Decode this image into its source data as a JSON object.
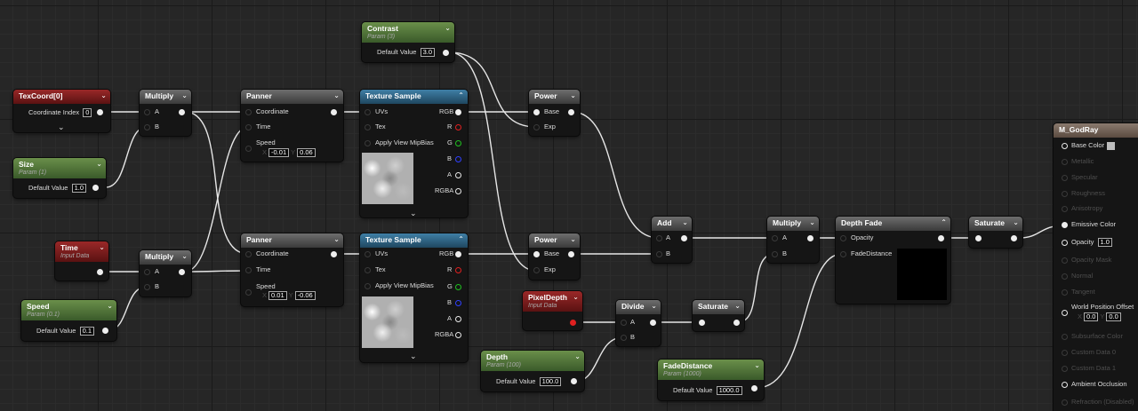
{
  "nodes": {
    "texcoord": {
      "title": "TexCoord[0]",
      "coordinate_index_label": "Coordinate Index",
      "coordinate_index_value": "0"
    },
    "size": {
      "title": "Size",
      "subtitle": "Param (1)",
      "default_label": "Default Value",
      "default_value": "1.0"
    },
    "time": {
      "title": "Time",
      "subtitle": "Input Data"
    },
    "speed": {
      "title": "Speed",
      "subtitle": "Param (0.1)",
      "default_label": "Default Value",
      "default_value": "0.1"
    },
    "multiply1": {
      "title": "Multiply",
      "pin_a": "A",
      "pin_b": "B"
    },
    "multiply2": {
      "title": "Multiply",
      "pin_a": "A",
      "pin_b": "B"
    },
    "panner1": {
      "title": "Panner",
      "coordinate": "Coordinate",
      "time": "Time",
      "speed": "Speed",
      "x_label": "X",
      "x_value": "-0.01",
      "y_label": "Y",
      "y_value": "0.06"
    },
    "panner2": {
      "title": "Panner",
      "coordinate": "Coordinate",
      "time": "Time",
      "speed": "Speed",
      "x_label": "X",
      "x_value": "0.01",
      "y_label": "Y",
      "y_value": "-0.06"
    },
    "contrast": {
      "title": "Contrast",
      "subtitle": "Param (3)",
      "default_label": "Default Value",
      "default_value": "3.0"
    },
    "texsample1": {
      "title": "Texture Sample",
      "uvs": "UVs",
      "tex": "Tex",
      "mip": "Apply View MipBias",
      "rgb": "RGB",
      "r": "R",
      "g": "G",
      "b": "B",
      "a": "A",
      "rgba": "RGBA"
    },
    "texsample2": {
      "title": "Texture Sample",
      "uvs": "UVs",
      "tex": "Tex",
      "mip": "Apply View MipBias",
      "rgb": "RGB",
      "r": "R",
      "g": "G",
      "b": "B",
      "a": "A",
      "rgba": "RGBA"
    },
    "power1": {
      "title": "Power",
      "base": "Base",
      "exp": "Exp"
    },
    "power2": {
      "title": "Power",
      "base": "Base",
      "exp": "Exp"
    },
    "pixeldepth": {
      "title": "PixelDepth",
      "subtitle": "Input Data"
    },
    "depth": {
      "title": "Depth",
      "subtitle": "Param (100)",
      "default_label": "Default Value",
      "default_value": "100.0"
    },
    "add": {
      "title": "Add",
      "pin_a": "A",
      "pin_b": "B"
    },
    "divide": {
      "title": "Divide",
      "pin_a": "A",
      "pin_b": "B"
    },
    "saturate1": {
      "title": "Saturate"
    },
    "multiply3": {
      "title": "Multiply",
      "pin_a": "A",
      "pin_b": "B"
    },
    "fadedistance": {
      "title": "FadeDistance",
      "subtitle": "Param (1000)",
      "default_label": "Default Value",
      "default_value": "1000.0"
    },
    "depthfade": {
      "title": "Depth Fade",
      "opacity": "Opacity",
      "fade_distance": "FadeDistance"
    },
    "saturate2": {
      "title": "Saturate"
    },
    "material": {
      "title": "M_GodRay",
      "base_color": "Base Color",
      "metallic": "Metallic",
      "specular": "Specular",
      "roughness": "Roughness",
      "anisotropy": "Anisotropy",
      "emissive": "Emissive Color",
      "opacity": "Opacity",
      "opacity_value": "1.0",
      "opacity_mask": "Opacity Mask",
      "normal": "Normal",
      "tangent": "Tangent",
      "wpo": "World Position Offset",
      "wpo_x_label": "X",
      "wpo_x": "0.0",
      "wpo_y_label": "Y",
      "wpo_y": "0.0",
      "subsurface": "Subsurface Color",
      "custom0": "Custom Data 0",
      "custom1": "Custom Data 1",
      "ao": "Ambient Occlusion",
      "refraction": "Refraction (Disabled)"
    }
  },
  "colors": {
    "param_header": "#5a7f3a",
    "input_header": "#8a2020",
    "math_header": "#555555",
    "texture_header": "#2f6a90",
    "material_header": "#7a6a5e",
    "wire": "#e6e6e6",
    "pin_r": "#e02020",
    "pin_g": "#20c020",
    "pin_b": "#3040ff"
  },
  "icons": {
    "chevron": "chevron-down-icon",
    "collapse": "chevron-up-icon"
  }
}
